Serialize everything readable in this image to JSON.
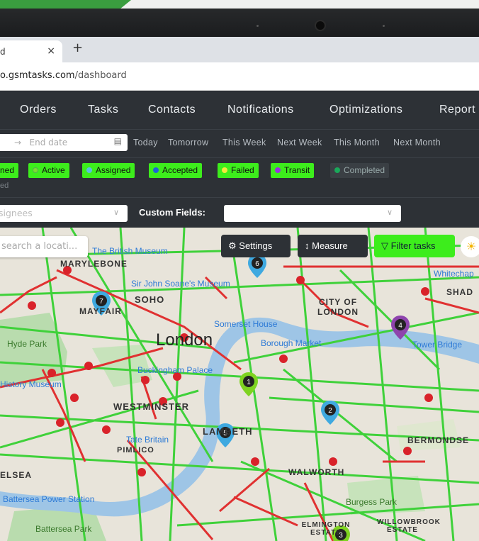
{
  "browser": {
    "tab_title": "d",
    "tab_close": "×",
    "new_tab": "+",
    "url_host": "o.gsmtasks.com",
    "url_path": "/dashboard"
  },
  "nav": {
    "items": [
      "Orders",
      "Tasks",
      "Contacts",
      "Notifications",
      "Optimizations",
      "Report"
    ]
  },
  "filters": {
    "end_date_placeholder": "End date",
    "date_arrow": "→",
    "quick_ranges": [
      "Today",
      "Tomorrow",
      "This Week",
      "Next Week",
      "This Month",
      "Next Month"
    ],
    "statuses": [
      {
        "label": "ned",
        "dot_color": "#3ded1c",
        "active": true
      },
      {
        "label": "Active",
        "dot_color": "#7be02f",
        "active": true
      },
      {
        "label": "Assigned",
        "dot_color": "#5bc0de",
        "active": true
      },
      {
        "label": "Accepted",
        "dot_color": "#1e63d6",
        "active": true
      },
      {
        "label": "Failed",
        "dot_color": "#f5e83b",
        "active": true
      },
      {
        "label": "Transit",
        "dot_color": "#9b30e0",
        "active": true
      },
      {
        "label": "Completed",
        "dot_color": "#1aa85a",
        "active": false
      }
    ],
    "status_overflow": "ed",
    "assignees_placeholder": "signees",
    "custom_fields_label": "Custom Fields:",
    "custom_fields_value": ""
  },
  "map": {
    "search_placeholder": "search a locati...",
    "settings_label": "Settings",
    "measure_label": "Measure",
    "filter_label": "Filter tasks",
    "city_label": "London",
    "place_labels": [
      "The British Museum",
      "MARYLEBONE",
      "Sir John Soane's Museum",
      "SOHO",
      "MAYFAIR",
      "CITY OF LONDON",
      "Somerset House",
      "Borough Market",
      "Tower Bridge",
      "Hyde Park",
      "Buckingham Palace",
      "History Museum",
      "WESTMINSTER",
      "Tate Britain",
      "PIMLICO",
      "LAMBETH",
      "BERMONDSE",
      "Whitechap",
      "SHAD",
      "ELSEA",
      "Battersea Power Station",
      "WALWORTH",
      "Burgess Park",
      "Battersea Park",
      "ELMINGTON ESTATE",
      "WILLOWBROOK ESTATE"
    ],
    "markers": [
      {
        "n": "1",
        "color": "#7ed321"
      },
      {
        "n": "2",
        "color": "#3fa9e0"
      },
      {
        "n": "3",
        "color": "#7ed321"
      },
      {
        "n": "4",
        "color": "#8e44ad"
      },
      {
        "n": "5",
        "color": "#3fa9e0"
      },
      {
        "n": "6",
        "color": "#3fa9e0"
      },
      {
        "n": "7",
        "color": "#3fa9e0"
      }
    ]
  },
  "colors": {
    "accent_green": "#3ded1c",
    "nav_bg": "#2d3136",
    "traffic_green": "#3fd13a",
    "traffic_red": "#e03131",
    "river": "#9ec5e6"
  }
}
